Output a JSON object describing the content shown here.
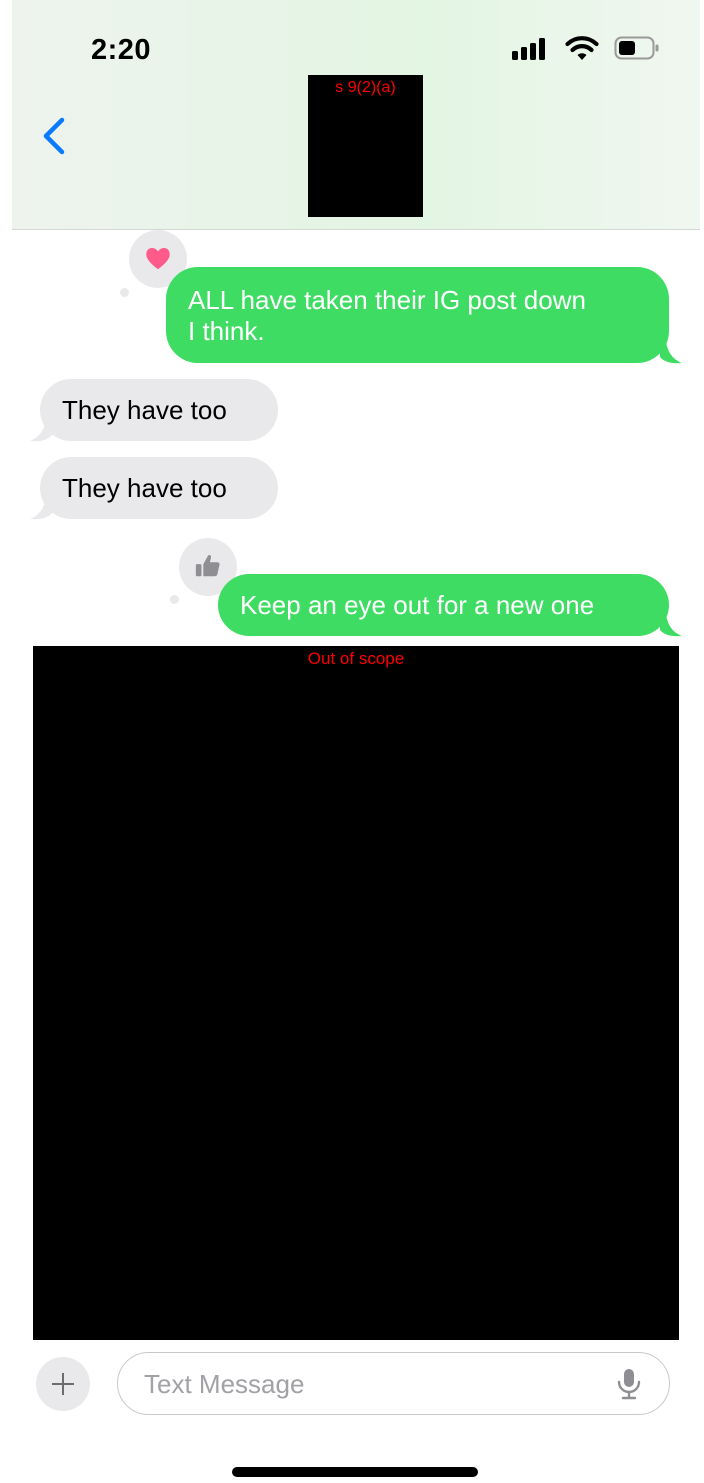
{
  "status_bar": {
    "time": "2:20"
  },
  "header": {
    "redaction_label": "s 9(2)(a)"
  },
  "messages": [
    {
      "direction": "sent",
      "line1": "ALL have taken their IG post down",
      "line2": "I think.",
      "reaction": "heart"
    },
    {
      "direction": "received",
      "text": "They have too"
    },
    {
      "direction": "received",
      "text": "They have too"
    },
    {
      "direction": "sent",
      "text": "Keep an eye out for a new one",
      "reaction": "thumbs-up"
    }
  ],
  "redacted_block": {
    "label": "Out of scope"
  },
  "input": {
    "placeholder": "Text Message",
    "value": ""
  },
  "colors": {
    "sent_bubble": "#3fdc63",
    "received_bubble": "#e9e9eb",
    "accent": "#0a7aff",
    "heart": "#ff5b8a",
    "redaction_text": "#ff0000"
  }
}
